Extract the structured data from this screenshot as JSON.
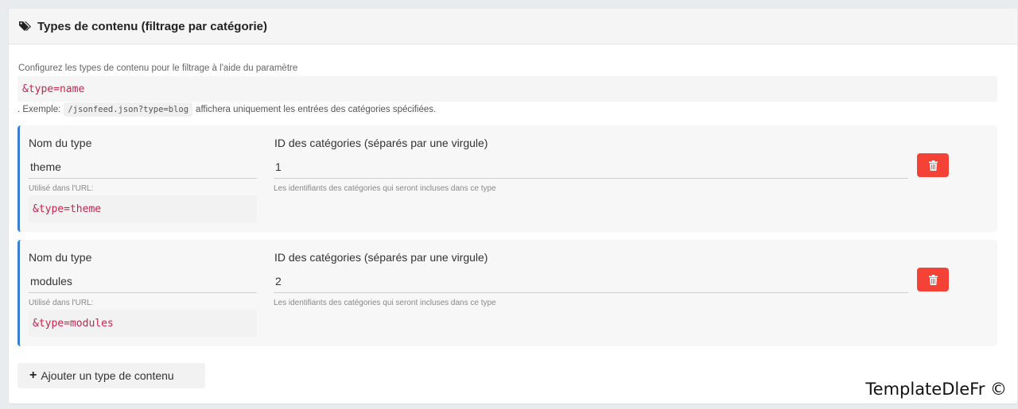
{
  "panel": {
    "title": "Types de contenu (filtrage par catégorie)",
    "title_icon": "tags-icon"
  },
  "intro": {
    "description": "Configurez les types de contenu pour le filtrage à l'aide du paramètre",
    "param_code": "&type=name",
    "example_prefix": ". Exemple:",
    "example_code": "/jsonfeed.json?type=blog",
    "example_suffix": "affichera uniquement les entrées des catégories spécifiées."
  },
  "types": [
    {
      "name_label": "Nom du type",
      "name_value": "theme",
      "ids_label": "ID des catégories (séparés par une virgule)",
      "ids_value": "1",
      "url_hint": "Utilisé dans l'URL:",
      "url_code": "&type=theme",
      "ids_hint": "Les identifiants des catégories qui seront incluses dans ce type"
    },
    {
      "name_label": "Nom du type",
      "name_value": "modules",
      "ids_label": "ID des catégories (séparés par une virgule)",
      "ids_value": "2",
      "url_hint": "Utilisé dans l'URL:",
      "url_code": "&type=modules",
      "ids_hint": "Les identifiants des catégories qui seront incluses dans ce type"
    }
  ],
  "add_button": {
    "icon": "+",
    "label": "Ajouter un type de contenu"
  },
  "watermark": "TemplateDleFr ©",
  "colors": {
    "accent_border": "#3b7fd0",
    "delete_button": "#f44336",
    "code_text": "#c7254e"
  }
}
